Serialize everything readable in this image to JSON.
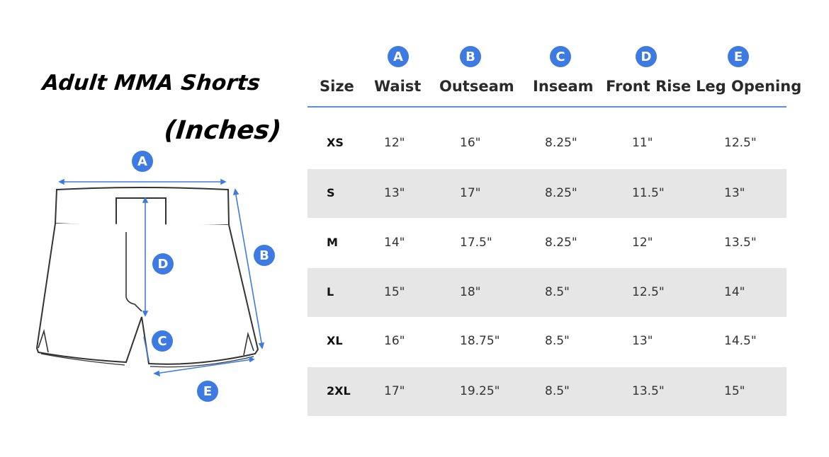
{
  "title": "Adult MMA Shorts",
  "subtitle": "(Inches)",
  "accent_color": "#3d7be2",
  "diagram_labels": {
    "a": "A",
    "b": "B",
    "c": "C",
    "d": "D",
    "e": "E"
  },
  "table": {
    "badges": [
      "A",
      "B",
      "C",
      "D",
      "E"
    ],
    "headers": [
      "Size",
      "Waist",
      "Outseam",
      "Inseam",
      "Front Rise",
      "Leg Opening"
    ],
    "rows": [
      [
        "XS",
        "12\"",
        "16\"",
        "8.25\"",
        "11\"",
        "12.5\""
      ],
      [
        "S",
        "13\"",
        "17\"",
        "8.25\"",
        "11.5\"",
        "13\""
      ],
      [
        "M",
        "14\"",
        "17.5\"",
        "8.25\"",
        "12\"",
        "13.5\""
      ],
      [
        "L",
        "15\"",
        "18\"",
        "8.5\"",
        "12.5\"",
        "14\""
      ],
      [
        "XL",
        "16\"",
        "18.75\"",
        "8.5\"",
        "13\"",
        "14.5\""
      ],
      [
        "2XL",
        "17\"",
        "19.25\"",
        "8.5\"",
        "13.5\"",
        "15\""
      ]
    ]
  }
}
